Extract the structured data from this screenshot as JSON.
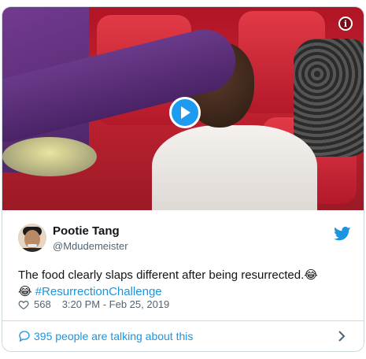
{
  "tweet": {
    "author_name": "Pootie Tang",
    "author_handle": "@Mdudemeister",
    "text_main": "The food clearly slaps different after being resurrected.",
    "emoji_1": "😂",
    "emoji_2": "😂",
    "hashtag": "#ResurrectionChallenge",
    "likes": "568",
    "timestamp": "3:20 PM - Feb 25, 2019",
    "footer_link": "395 people are talking about this"
  },
  "icons": {
    "play": "play-icon",
    "info": "info-icon",
    "brand": "twitter-bird-icon",
    "like": "heart-icon",
    "reply": "speech-bubble-icon",
    "more": "chevron-right-icon"
  },
  "colors": {
    "accent": "#1b95e0",
    "play_button": "#1d9bf0",
    "text": "#0f1419",
    "muted": "#536471",
    "border": "#cfd9de"
  }
}
